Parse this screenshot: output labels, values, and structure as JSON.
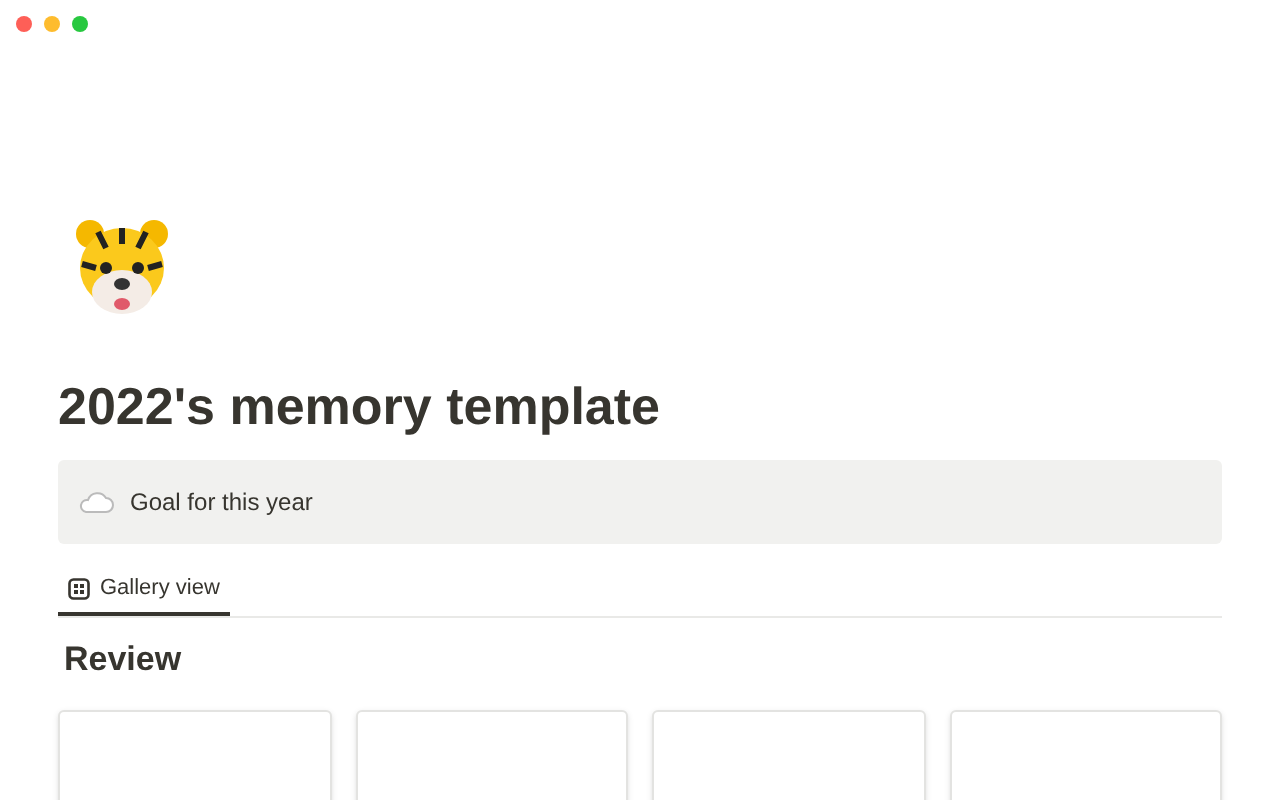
{
  "page": {
    "title": "2022's memory template"
  },
  "callout": {
    "text": "Goal for this year"
  },
  "tabs": [
    {
      "label": "Gallery view",
      "selected": true
    }
  ],
  "section": {
    "heading": "Review"
  },
  "cards": [
    {
      "kind": "empty"
    },
    {
      "kind": "empty"
    },
    {
      "kind": "empty"
    },
    {
      "kind": "empty"
    }
  ]
}
